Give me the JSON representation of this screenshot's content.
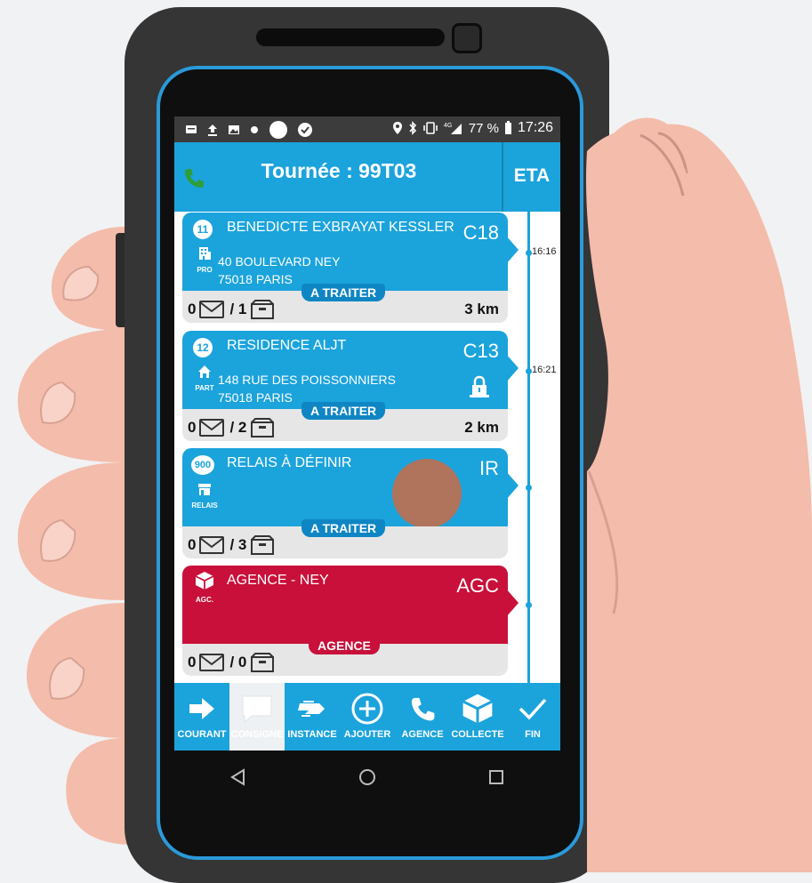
{
  "status_bar": {
    "battery": "77 %",
    "time": "17:26",
    "network": "4G"
  },
  "app_bar": {
    "title": "Tournée : 99T03",
    "eta_label": "ETA"
  },
  "timeline": {
    "times": [
      "16:16",
      "16:21"
    ]
  },
  "stops": [
    {
      "number": "11",
      "name": "BENEDICTE EXBRAYAT KESSLER",
      "code": "C18",
      "type_label": "PRO",
      "type_icon": "building-icon",
      "address_line1": "40 BOULEVARD NEY",
      "address_line2": "75018 PARIS",
      "status": "A TRAITER",
      "letters": "0",
      "parcels": "/ 1",
      "distance": "3 km",
      "color": "#1ba3dc"
    },
    {
      "number": "12",
      "name": "RESIDENCE ALJT",
      "code": "C13",
      "type_label": "PART",
      "type_icon": "house-icon",
      "address_line1": "148 RUE DES POISSONNIERS",
      "address_line2": "75018 PARIS",
      "status": "A TRAITER",
      "letters": "0",
      "parcels": "/ 2",
      "distance": "2 km",
      "color": "#1ba3dc"
    },
    {
      "number": "900",
      "name": "RELAIS À DÉFINIR",
      "code": "IR",
      "type_label": "RELAIS",
      "type_icon": "shop-icon",
      "status": "A TRAITER",
      "letters": "0",
      "parcels": "/ 3",
      "color": "#1ba3dc"
    },
    {
      "name": "AGENCE - NEY",
      "code": "AGC",
      "type_label": "AGC.",
      "type_icon": "box-icon",
      "status": "AGENCE",
      "letters": "0",
      "parcels": "/ 0",
      "color": "#c8103a"
    }
  ],
  "bottom_nav": [
    {
      "label": "COURANT",
      "icon": "arrow-right-icon"
    },
    {
      "label": "CONSIGNE",
      "icon": "speech-bubble-icon",
      "active": true
    },
    {
      "label": "INSTANCE",
      "icon": "fast-forward-icon"
    },
    {
      "label": "AJOUTER",
      "icon": "add-circle-icon"
    },
    {
      "label": "AGENCE",
      "icon": "phone-icon"
    },
    {
      "label": "COLLECTE",
      "icon": "package-icon"
    },
    {
      "label": "FIN",
      "icon": "check-icon"
    }
  ],
  "colors": {
    "primary_blue": "#1ba3dc",
    "agency_red": "#c8103a",
    "status_pill_blue": "#0f86c4",
    "call_green": "#2e9e3a"
  }
}
